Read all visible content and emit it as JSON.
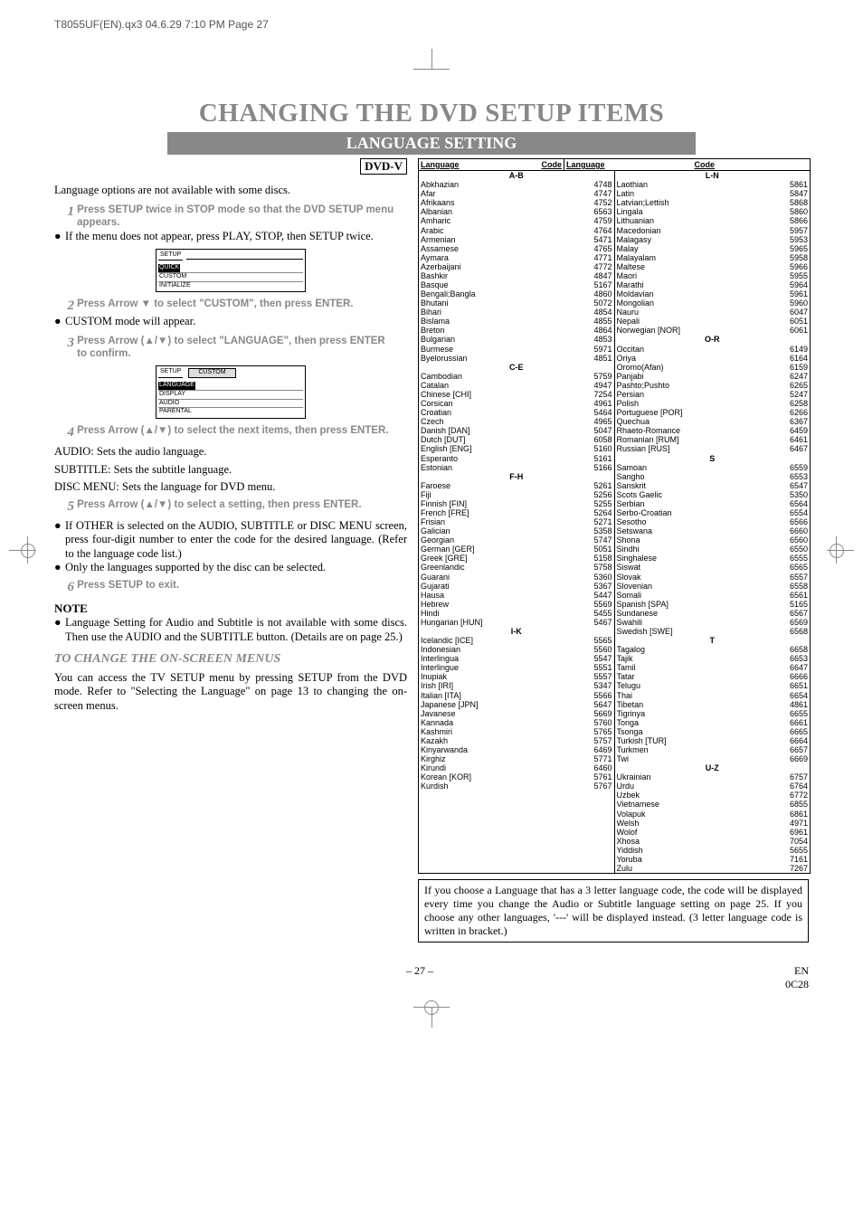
{
  "header_line": "T8055UF(EN).qx3  04.6.29  7:10 PM  Page 27",
  "main_title": "CHANGING THE DVD SETUP ITEMS",
  "section_title": "LANGUAGE SETTING",
  "dvd_label": "DVD-V",
  "intro": "Language options are not available with some discs.",
  "steps": {
    "s1": "Press SETUP twice in STOP mode so that the DVD SETUP menu appears.",
    "s1_note": "If the menu does not appear, press PLAY, STOP, then SETUP twice.",
    "ui1": {
      "title": "SETUP",
      "items": [
        "QUICK",
        "CUSTOM",
        "INITIALIZE"
      ]
    },
    "s2": "Press Arrow ▼ to select \"CUSTOM\", then press ENTER.",
    "s2_note": "CUSTOM mode will appear.",
    "s3": "Press Arrow (▲/▼) to select \"LANGUAGE\", then press ENTER to confirm.",
    "ui2": {
      "title": "SETUP",
      "tab": "CUSTOM",
      "items": [
        "LANGUAGE",
        "DISPLAY",
        "AUDIO",
        "PARENTAL"
      ]
    },
    "s4": "Press Arrow (▲/▼) to select the next items, then press ENTER.",
    "audio_line": "AUDIO:  Sets the audio language.",
    "subtitle_line": "SUBTITLE:  Sets the subtitle language.",
    "discmenu_line": "DISC MENU:  Sets the language for DVD menu.",
    "s5": "Press Arrow (▲/▼) to select a setting, then press ENTER.",
    "s5_b1": "If OTHER is selected on the AUDIO, SUBTITLE or DISC MENU screen, press four-digit number to enter the code for the desired language. (Refer to the language code list.)",
    "s5_b2": "Only the languages supported by the disc can be selected.",
    "s6": "Press SETUP to exit."
  },
  "note_title": "NOTE",
  "note_body": "Language Setting for Audio and Subtitle is not available with some discs. Then use the AUDIO and the SUBTITLE button. (Details are on page 25.)",
  "tochange_title": "TO CHANGE THE ON-SCREEN MENUS",
  "tochange_body": "You can access the TV SETUP menu by pressing SETUP from the DVD mode. Refer to \"Selecting the Language\" on page 13 to changing the on-screen menus.",
  "table_hdr": {
    "lang": "Language",
    "code": "Code"
  },
  "groups_left": [
    "A-B",
    "C-E",
    "F-H",
    "I-K"
  ],
  "groups_right": [
    "L-N",
    "O-R",
    "S",
    "T",
    "U-Z"
  ],
  "langs_left": [
    {
      "g": "A-B"
    },
    {
      "n": "Abkhazian",
      "c": "4748"
    },
    {
      "n": "Afar",
      "c": "4747"
    },
    {
      "n": "Afrikaans",
      "c": "4752"
    },
    {
      "n": "Albanian",
      "c": "6563"
    },
    {
      "n": "Amharic",
      "c": "4759"
    },
    {
      "n": "Arabic",
      "c": "4764"
    },
    {
      "n": "Armenian",
      "c": "5471"
    },
    {
      "n": "Assamese",
      "c": "4765"
    },
    {
      "n": "Aymara",
      "c": "4771"
    },
    {
      "n": "Azerbaijani",
      "c": "4772"
    },
    {
      "n": "Bashkir",
      "c": "4847"
    },
    {
      "n": "Basque",
      "c": "5167"
    },
    {
      "n": "Bengali;Bangla",
      "c": "4860"
    },
    {
      "n": "Bhutani",
      "c": "5072"
    },
    {
      "n": "Bihari",
      "c": "4854"
    },
    {
      "n": "Bislama",
      "c": "4855"
    },
    {
      "n": "Breton",
      "c": "4864"
    },
    {
      "n": "Bulgarian",
      "c": "4853"
    },
    {
      "n": "Burmese",
      "c": "5971"
    },
    {
      "n": "Byelorussian",
      "c": "4851"
    },
    {
      "g": "C-E"
    },
    {
      "n": "Cambodian",
      "c": "5759"
    },
    {
      "n": "Catalan",
      "c": "4947"
    },
    {
      "n": "Chinese [CHI]",
      "c": "7254"
    },
    {
      "n": "Corsican",
      "c": "4961"
    },
    {
      "n": "Croatian",
      "c": "5464"
    },
    {
      "n": "Czech",
      "c": "4965"
    },
    {
      "n": "Danish [DAN]",
      "c": "5047"
    },
    {
      "n": "Dutch [DUT]",
      "c": "6058"
    },
    {
      "n": "English [ENG]",
      "c": "5160"
    },
    {
      "n": "Esperanto",
      "c": "5161"
    },
    {
      "n": "Estonian",
      "c": "5166"
    },
    {
      "g": "F-H"
    },
    {
      "n": "Faroese",
      "c": "5261"
    },
    {
      "n": "Fiji",
      "c": "5256"
    },
    {
      "n": "Finnish [FIN]",
      "c": "5255"
    },
    {
      "n": "French [FRE]",
      "c": "5264"
    },
    {
      "n": "Frisian",
      "c": "5271"
    },
    {
      "n": "Galician",
      "c": "5358"
    },
    {
      "n": "Georgian",
      "c": "5747"
    },
    {
      "n": "German [GER]",
      "c": "5051"
    },
    {
      "n": "Greek [GRE]",
      "c": "5158"
    },
    {
      "n": "Greenlandic",
      "c": "5758"
    },
    {
      "n": "Guarani",
      "c": "5360"
    },
    {
      "n": "Gujarati",
      "c": "5367"
    },
    {
      "n": "Hausa",
      "c": "5447"
    },
    {
      "n": "Hebrew",
      "c": "5569"
    },
    {
      "n": "Hindi",
      "c": "5455"
    },
    {
      "n": "Hungarian [HUN]",
      "c": "5467"
    },
    {
      "g": "I-K"
    },
    {
      "n": "Icelandic [ICE]",
      "c": "5565"
    },
    {
      "n": "Indonesian",
      "c": "5560"
    },
    {
      "n": "Interlingua",
      "c": "5547"
    },
    {
      "n": "Interlingue",
      "c": "5551"
    },
    {
      "n": "Inupiak",
      "c": "5557"
    },
    {
      "n": "Irish [IRI]",
      "c": "5347"
    },
    {
      "n": "Italian [ITA]",
      "c": "5566"
    },
    {
      "n": "Japanese [JPN]",
      "c": "5647"
    },
    {
      "n": "Javanese",
      "c": "5669"
    },
    {
      "n": "Kannada",
      "c": "5760"
    },
    {
      "n": "Kashmiri",
      "c": "5765"
    },
    {
      "n": "Kazakh",
      "c": "5757"
    },
    {
      "n": "Kinyarwanda",
      "c": "6469"
    },
    {
      "n": "Kirghiz",
      "c": "5771"
    },
    {
      "n": "Kirundi",
      "c": "6460"
    },
    {
      "n": "Korean [KOR]",
      "c": "5761"
    },
    {
      "n": "Kurdish",
      "c": "5767"
    }
  ],
  "langs_right": [
    {
      "g": "L-N"
    },
    {
      "n": "Laothian",
      "c": "5861"
    },
    {
      "n": "Latin",
      "c": "5847"
    },
    {
      "n": "Latvian;Lettish",
      "c": "5868"
    },
    {
      "n": "Lingala",
      "c": "5860"
    },
    {
      "n": "Lithuanian",
      "c": "5866"
    },
    {
      "n": "Macedonian",
      "c": "5957"
    },
    {
      "n": "Malagasy",
      "c": "5953"
    },
    {
      "n": "Malay",
      "c": "5965"
    },
    {
      "n": "Malayalam",
      "c": "5958"
    },
    {
      "n": "Maltese",
      "c": "5966"
    },
    {
      "n": "Maori",
      "c": "5955"
    },
    {
      "n": "Marathi",
      "c": "5964"
    },
    {
      "n": "Moldavian",
      "c": "5961"
    },
    {
      "n": "Mongolian",
      "c": "5960"
    },
    {
      "n": "Nauru",
      "c": "6047"
    },
    {
      "n": "Nepali",
      "c": "6051"
    },
    {
      "n": "Norwegian [NOR]",
      "c": "6061"
    },
    {
      "g": "O-R"
    },
    {
      "n": "Occitan",
      "c": "6149"
    },
    {
      "n": "Oriya",
      "c": "6164"
    },
    {
      "n": "Oromo(Afan)",
      "c": "6159"
    },
    {
      "n": "Panjabi",
      "c": "6247"
    },
    {
      "n": "Pashto;Pushto",
      "c": "6265"
    },
    {
      "n": "Persian",
      "c": "5247"
    },
    {
      "n": "Polish",
      "c": "6258"
    },
    {
      "n": "Portuguese [POR]",
      "c": "6266"
    },
    {
      "n": "Quechua",
      "c": "6367"
    },
    {
      "n": "Rhaeto-Romance",
      "c": "6459"
    },
    {
      "n": "Romanian [RUM]",
      "c": "6461"
    },
    {
      "n": "Russian [RUS]",
      "c": "6467"
    },
    {
      "g": "S"
    },
    {
      "n": "Samoan",
      "c": "6559"
    },
    {
      "n": "Sangho",
      "c": "6553"
    },
    {
      "n": "Sanskrit",
      "c": "6547"
    },
    {
      "n": "Scots Gaelic",
      "c": "5350"
    },
    {
      "n": "Serbian",
      "c": "6564"
    },
    {
      "n": "Serbo-Croatian",
      "c": "6554"
    },
    {
      "n": "Sesotho",
      "c": "6566"
    },
    {
      "n": "Setswana",
      "c": "6660"
    },
    {
      "n": "Shona",
      "c": "6560"
    },
    {
      "n": "Sindhi",
      "c": "6550"
    },
    {
      "n": "Singhalese",
      "c": "6555"
    },
    {
      "n": "Siswat",
      "c": "6565"
    },
    {
      "n": "Slovak",
      "c": "6557"
    },
    {
      "n": "Slovenian",
      "c": "6558"
    },
    {
      "n": "Somali",
      "c": "6561"
    },
    {
      "n": "Spanish [SPA]",
      "c": "5165"
    },
    {
      "n": "Sundanese",
      "c": "6567"
    },
    {
      "n": "Swahili",
      "c": "6569"
    },
    {
      "n": "Swedish [SWE]",
      "c": "6568"
    },
    {
      "g": "T"
    },
    {
      "n": "Tagalog",
      "c": "6658"
    },
    {
      "n": "Tajik",
      "c": "6653"
    },
    {
      "n": "Tamil",
      "c": "6647"
    },
    {
      "n": "Tatar",
      "c": "6666"
    },
    {
      "n": "Telugu",
      "c": "6651"
    },
    {
      "n": "Thai",
      "c": "6654"
    },
    {
      "n": "Tibetan",
      "c": "4861"
    },
    {
      "n": "Tigrinya",
      "c": "6655"
    },
    {
      "n": "Tonga",
      "c": "6661"
    },
    {
      "n": "Tsonga",
      "c": "6665"
    },
    {
      "n": "Turkish [TUR]",
      "c": "6664"
    },
    {
      "n": "Turkmen",
      "c": "6657"
    },
    {
      "n": "Twi",
      "c": "6669"
    },
    {
      "g": "U-Z"
    },
    {
      "n": "Ukrainian",
      "c": "6757"
    },
    {
      "n": "Urdu",
      "c": "6764"
    },
    {
      "n": "Uzbek",
      "c": "6772"
    },
    {
      "n": "Vietnamese",
      "c": "6855"
    },
    {
      "n": "Volapuk",
      "c": "6861"
    },
    {
      "n": "Welsh",
      "c": "4971"
    },
    {
      "n": "Wolof",
      "c": "6961"
    },
    {
      "n": "Xhosa",
      "c": "7054"
    },
    {
      "n": "Yiddish",
      "c": "5655"
    },
    {
      "n": "Yoruba",
      "c": "7161"
    },
    {
      "n": "Zulu",
      "c": "7267"
    }
  ],
  "note_box": "If you choose a Language that has a 3 letter language code, the code will be displayed every time you change the Audio or Subtitle language setting on page 25. If you choose any other languages, '---' will be displayed instead. (3 letter language code is written in bracket.)",
  "footer": {
    "page": "– 27 –",
    "en": "EN",
    "code": "0C28"
  }
}
